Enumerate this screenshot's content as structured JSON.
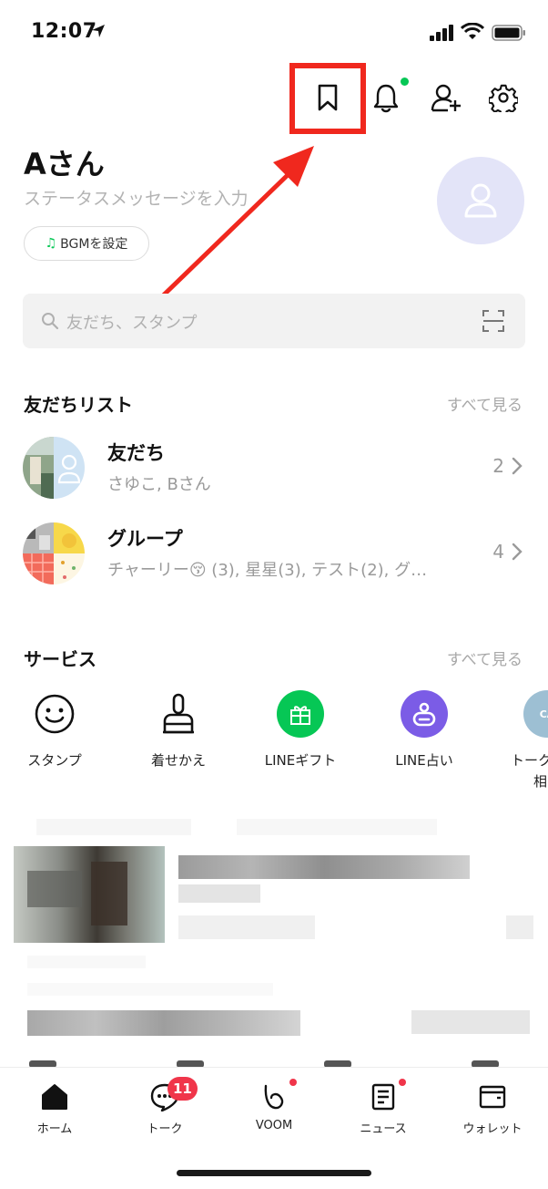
{
  "status_bar": {
    "time": "12:07"
  },
  "header": {
    "icons": [
      "bookmark-icon",
      "bell-icon",
      "add-friend-icon",
      "gear-icon"
    ]
  },
  "profile": {
    "name": "Aさん",
    "status_placeholder": "ステータスメッセージを入力",
    "bgm_label": "BGMを設定"
  },
  "search": {
    "placeholder": "友だち、スタンプ"
  },
  "friends_section": {
    "title": "友だちリスト",
    "see_all": "すべて見る",
    "rows": [
      {
        "title": "友だち",
        "subtitle": "さゆこ, Bさん",
        "count": "2"
      },
      {
        "title": "グループ",
        "subtitle": "チャーリー😚 (3), 星星(3), テスト(2), グ…",
        "count": "4"
      }
    ]
  },
  "services_section": {
    "title": "サービス",
    "see_all": "すべて見る",
    "items": [
      {
        "label": "スタンプ",
        "icon": "smiley-icon"
      },
      {
        "label": "着せかえ",
        "icon": "brush-icon"
      },
      {
        "label": "LINEギフト",
        "icon": "gift-icon"
      },
      {
        "label": "LINE占い",
        "icon": "fortune-icon"
      },
      {
        "label": "トーク",
        "label2": "相",
        "icon": "talk-care-icon"
      }
    ]
  },
  "bottom_nav": {
    "items": [
      {
        "label": "ホーム",
        "icon": "home-icon"
      },
      {
        "label": "トーク",
        "icon": "chat-icon",
        "badge": "11"
      },
      {
        "label": "VOOM",
        "icon": "voom-icon"
      },
      {
        "label": "ニュース",
        "icon": "news-icon"
      },
      {
        "label": "ウォレット",
        "icon": "wallet-icon"
      }
    ]
  },
  "colors": {
    "line_green": "#06c755",
    "annotation_red": "#f0281e",
    "badge_red": "#f0354a",
    "fortune_purple": "#7b5ce6",
    "avatar_lavender": "#e3e4f8"
  }
}
